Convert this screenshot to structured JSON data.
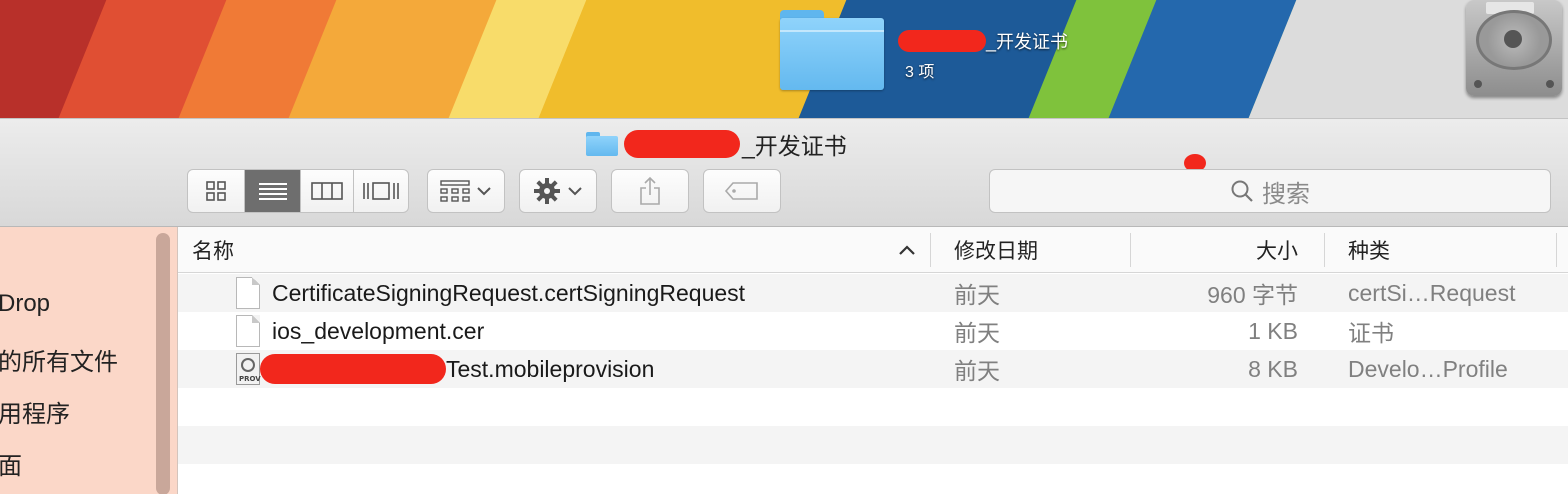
{
  "desktop": {
    "folder_label_suffix": "_开发证书",
    "folder_item_count": "3 项"
  },
  "window": {
    "title_suffix": "_开发证书"
  },
  "toolbar": {
    "view_icons": [
      "icon-view-icon",
      "list-view-icon",
      "column-view-icon",
      "coverflow-view-icon"
    ],
    "active_view": "list",
    "search_placeholder": "搜索"
  },
  "sidebar": {
    "items": [
      {
        "label": "Drop"
      },
      {
        "label": "的所有文件"
      },
      {
        "label": "用程序"
      },
      {
        "label": "面"
      }
    ]
  },
  "list": {
    "columns": {
      "name": "名称",
      "modified": "修改日期",
      "size": "大小",
      "kind": "种类"
    },
    "sort_indicator": "^",
    "files": [
      {
        "name": "CertificateSigningRequest.certSigningRequest",
        "modified": "前天",
        "size": "960 字节",
        "kind": "certSi…Request",
        "icon": "document-icon"
      },
      {
        "name": "ios_development.cer",
        "modified": "前天",
        "size": "1 KB",
        "kind": "证书",
        "icon": "document-icon"
      },
      {
        "name_suffix": "Test.mobileprovision",
        "modified": "前天",
        "size": "8 KB",
        "kind": "Develo…Profile",
        "icon": "provision-profile-icon",
        "icon_text": "PROV"
      }
    ]
  },
  "colors": {
    "redaction": "#f2271c",
    "sidebar_bg": "#fbd7c8",
    "folder_blue": "#64b9ef"
  }
}
